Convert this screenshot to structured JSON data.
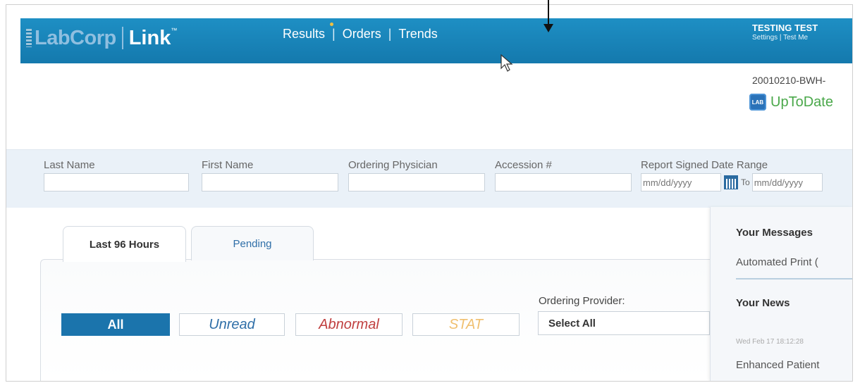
{
  "header": {
    "logo_brand": "LabCorp",
    "logo_product": "Link",
    "logo_tm": "™",
    "nav": [
      {
        "label": "Results"
      },
      {
        "label": "Orders"
      },
      {
        "label": "Trends"
      }
    ],
    "nav_separator": "|",
    "user_name": "TESTING TEST",
    "user_links": "Settings | Test Me",
    "brand_color": "#1479ad"
  },
  "info": {
    "account_id": "20010210-BWH-",
    "uptodate_badge": "LAB",
    "uptodate_label": "UpToDate"
  },
  "search": {
    "last_name_label": "Last Name",
    "first_name_label": "First Name",
    "physician_label": "Ordering Physician",
    "accession_label": "Accession #",
    "date_range_label": "Report Signed Date Range",
    "date_from_placeholder": "mm/dd/yyyy",
    "date_to_label": "To",
    "date_to_placeholder": "mm/dd/yyyy"
  },
  "tabs": [
    {
      "label": "Last 96 Hours",
      "active": true
    },
    {
      "label": "Pending",
      "active": false
    }
  ],
  "filters": {
    "all": "All",
    "unread": "Unread",
    "abnormal": "Abnormal",
    "stat": "STAT"
  },
  "provider": {
    "label": "Ordering Provider:",
    "selected": "Select All"
  },
  "side": {
    "messages_title": "Your Messages",
    "messages_item": "Automated Print (",
    "news_title": "Your News",
    "news_date": "Wed Feb 17 18:12:28",
    "news_item": "Enhanced Patient"
  }
}
